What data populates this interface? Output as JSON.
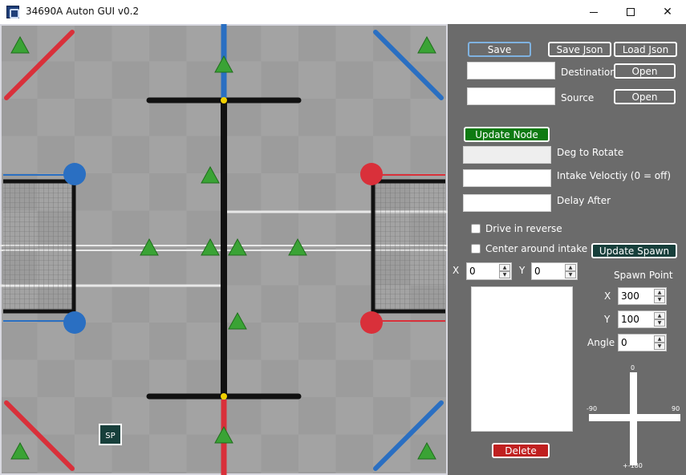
{
  "window": {
    "title": "34690A Auton GUI v0.2",
    "controls": {
      "minimize": "—",
      "maximize": "☐",
      "close": "✕"
    }
  },
  "field": {
    "spawn_marker_label": "SP"
  },
  "panel": {
    "save_label": "Save",
    "save_json_label": "Save Json",
    "load_json_label": "Load Json",
    "destination_label": "Destination",
    "destination_value": "",
    "destination_open_label": "Open",
    "source_label": "Source",
    "source_value": "",
    "source_open_label": "Open",
    "update_node_label": "Update Node",
    "deg_to_rotate_label": "Deg to Rotate",
    "deg_to_rotate_value": "",
    "intake_velocity_label": "Intake Veloctiy (0 = off)",
    "intake_velocity_value": "",
    "delay_after_label": "Delay After",
    "delay_after_value": "",
    "drive_reverse_label": "Drive in reverse",
    "drive_reverse_checked": false,
    "center_intake_label": "Center around intake",
    "center_intake_checked": false,
    "update_spawn_label": "Update Spawn",
    "x_label": "X",
    "x_value": "0",
    "y_label": "Y",
    "y_value": "0",
    "spawn_point_label": "Spawn Point",
    "spawn_x_label": "X",
    "spawn_x_value": "300",
    "spawn_y_label": "Y",
    "spawn_y_value": "100",
    "angle_label": "Angle",
    "angle_value": "0",
    "delete_label": "Delete",
    "dial": {
      "top": "0",
      "left": "-90",
      "right": "90",
      "bottom": "+-180"
    }
  },
  "colors": {
    "panel_bg": "#6b6b6b",
    "field_tile": "#9a9a9a",
    "red_alliance": "#d9303a",
    "blue_alliance": "#2a6fc2",
    "game_object": "#3aa335",
    "update_node_btn": "#0e7a12",
    "update_spawn_btn": "#173f3b",
    "delete_btn": "#c02020"
  }
}
